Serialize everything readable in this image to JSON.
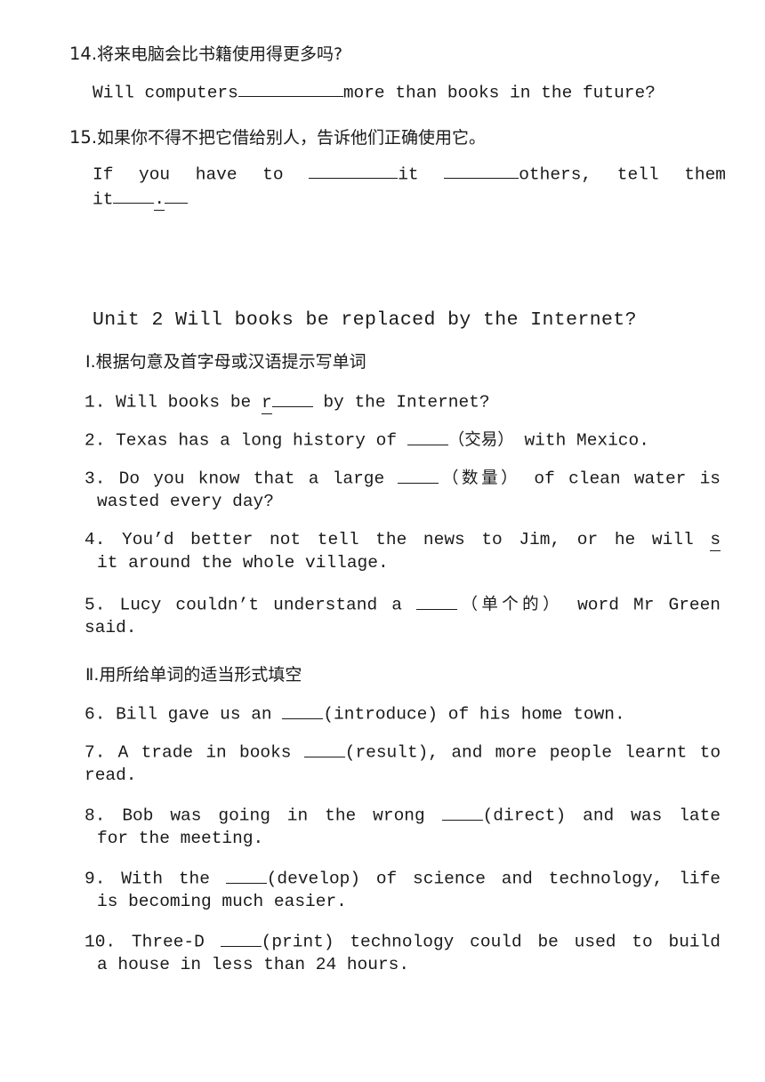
{
  "document": {
    "background": "#ffffff",
    "text_color": "#1a1a1a"
  },
  "top_items": [
    {
      "number": "14.",
      "chinese_prompt": "将来电脑会比书籍使用得更多吗?",
      "english_pre": "Will computers",
      "english_post": "more than books in the future?"
    },
    {
      "number": "15.",
      "chinese_prompt": "如果你不得不把它借给别人，告诉他们正确使用它。",
      "english_seg1": "If you have to ",
      "english_seg2": "it ",
      "english_seg3": "others, tell them",
      "english_line2_pre": "it",
      "english_line2_post": "."
    }
  ],
  "unit": {
    "title": "Unit 2 Will books be replaced by the Internet?"
  },
  "sections": [
    {
      "label": "Ⅰ.根据句意及首字母或汉语提示写单词",
      "items": [
        {
          "number": "1.",
          "line1_a": "Will books be ",
          "hint_letter": "r",
          "line1_b": " by the Internet?"
        },
        {
          "number": "2.",
          "line1_a": "Texas has a long history of ",
          "hint_cn": "（交易）",
          "line1_b": " with Mexico."
        },
        {
          "number": "3.",
          "line1_a": "Do you know that a large ",
          "hint_cn": "（数量）",
          "line1_b": " of clean water is",
          "line2": "wasted every day?"
        },
        {
          "number": "4.",
          "line1_a": "You’d better not tell the news to Jim, or he will ",
          "hint_letter": "s",
          "line2": "it around the whole village."
        },
        {
          "number": "5.",
          "line1_a": "Lucy couldn’t understand a ",
          "hint_cn": "（单个的）",
          "line1_b": " word Mr Green",
          "line2": "said."
        }
      ]
    },
    {
      "label": "Ⅱ.用所给单词的适当形式填空",
      "items": [
        {
          "number": "6.",
          "line1_a": "Bill gave us an ",
          "hint_en": "(introduce)",
          "line1_b": " of his home town."
        },
        {
          "number": "7.",
          "line1_a": "A trade in books ",
          "hint_en": "(result),",
          "line1_b": " and more people learnt to",
          "line2": "read."
        },
        {
          "number": "8.",
          "line1_a": "Bob was going in the wrong ",
          "hint_en": "(direct)",
          "line1_b": " and was late",
          "line2": "for the meeting."
        },
        {
          "number": "9.",
          "line1_a": "With the ",
          "hint_en": "(develop)",
          "line1_b": " of science and technology, life",
          "line2": "is becoming much easier."
        },
        {
          "number": "10.",
          "line1_a": "Three-D ",
          "hint_en": "(print)",
          "line1_b": " technology could be used to build",
          "line2": "a house in less than 24 hours."
        }
      ]
    }
  ]
}
